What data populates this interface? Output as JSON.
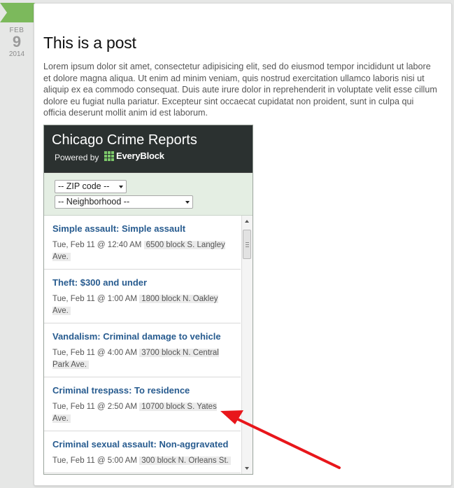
{
  "date": {
    "month": "FEB",
    "day": "9",
    "year": "2014"
  },
  "post": {
    "title": "This is a post",
    "body": "Lorem ipsum dolor sit amet, consectetur adipisicing elit, sed do eiusmod tempor incididunt ut labore et dolore magna aliqua. Ut enim ad minim veniam, quis nostrud exercitation ullamco laboris nisi ut aliquip ex ea commodo consequat. Duis aute irure dolor in reprehenderit in voluptate velit esse cillum dolore eu fugiat nulla pariatur. Excepteur sint occaecat cupidatat non proident, sunt in culpa qui officia deserunt mollit anim id est laborum."
  },
  "widget": {
    "title": "Chicago Crime Reports",
    "powered_by": "Powered by",
    "brand": "EveryBlock",
    "zip_select": "-- ZIP code --",
    "neighborhood_select": "-- Neighborhood --",
    "items": [
      {
        "title": "Simple assault: Simple assault",
        "time": "Tue, Feb 11 @ 12:40 AM",
        "location": "6500 block S. Langley Ave."
      },
      {
        "title": "Theft: $300 and under",
        "time": "Tue, Feb 11 @ 1:00 AM",
        "location": "1800 block N. Oakley Ave."
      },
      {
        "title": "Vandalism: Criminal damage to vehicle",
        "time": "Tue, Feb 11 @ 4:00 AM",
        "location": "3700 block N. Central Park Ave."
      },
      {
        "title": "Criminal trespass: To residence",
        "time": "Tue, Feb 11 @ 2:50 AM",
        "location": "10700 block S. Yates Ave."
      },
      {
        "title": "Criminal sexual assault: Non-aggravated",
        "time": "Tue, Feb 11 @ 5:00 AM",
        "location": "300 block N. Orleans St."
      }
    ]
  },
  "colors": {
    "accent_green": "#7cb95c",
    "link_blue": "#275b8f",
    "header_dark": "#2b3130",
    "annotation_red": "#e8161b"
  }
}
